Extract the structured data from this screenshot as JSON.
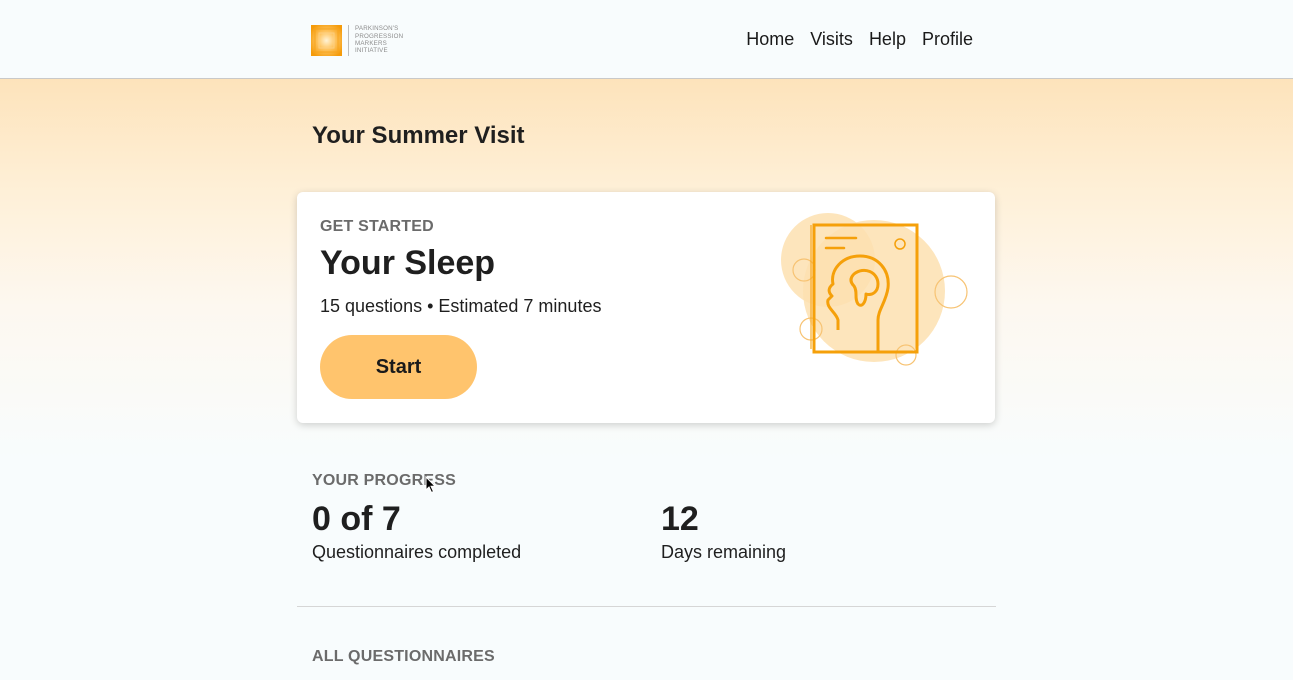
{
  "header": {
    "logo_lines": [
      "PARKINSON'S",
      "PROGRESSION",
      "MARKERS",
      "INITIATIVE"
    ],
    "nav": [
      "Home",
      "Visits",
      "Help",
      "Profile"
    ]
  },
  "page": {
    "title": "Your Summer Visit"
  },
  "card": {
    "eyebrow": "GET STARTED",
    "title": "Your Sleep",
    "meta": "15 questions • Estimated 7 minutes",
    "button_label": "Start",
    "illustration_icon": "head-profile-document-icon"
  },
  "progress": {
    "heading": "YOUR PROGRESS",
    "completed_value": "0 of 7",
    "completed_label": "Questionnaires completed",
    "days_value": "12",
    "days_label": "Days remaining"
  },
  "all_questionnaires": {
    "heading": "ALL QUESTIONNAIRES"
  },
  "colors": {
    "accent": "#ffc46d",
    "illustration_orange": "#f5a00a",
    "illustration_light": "#fde0b0",
    "hero_top": "#fde3bb"
  }
}
